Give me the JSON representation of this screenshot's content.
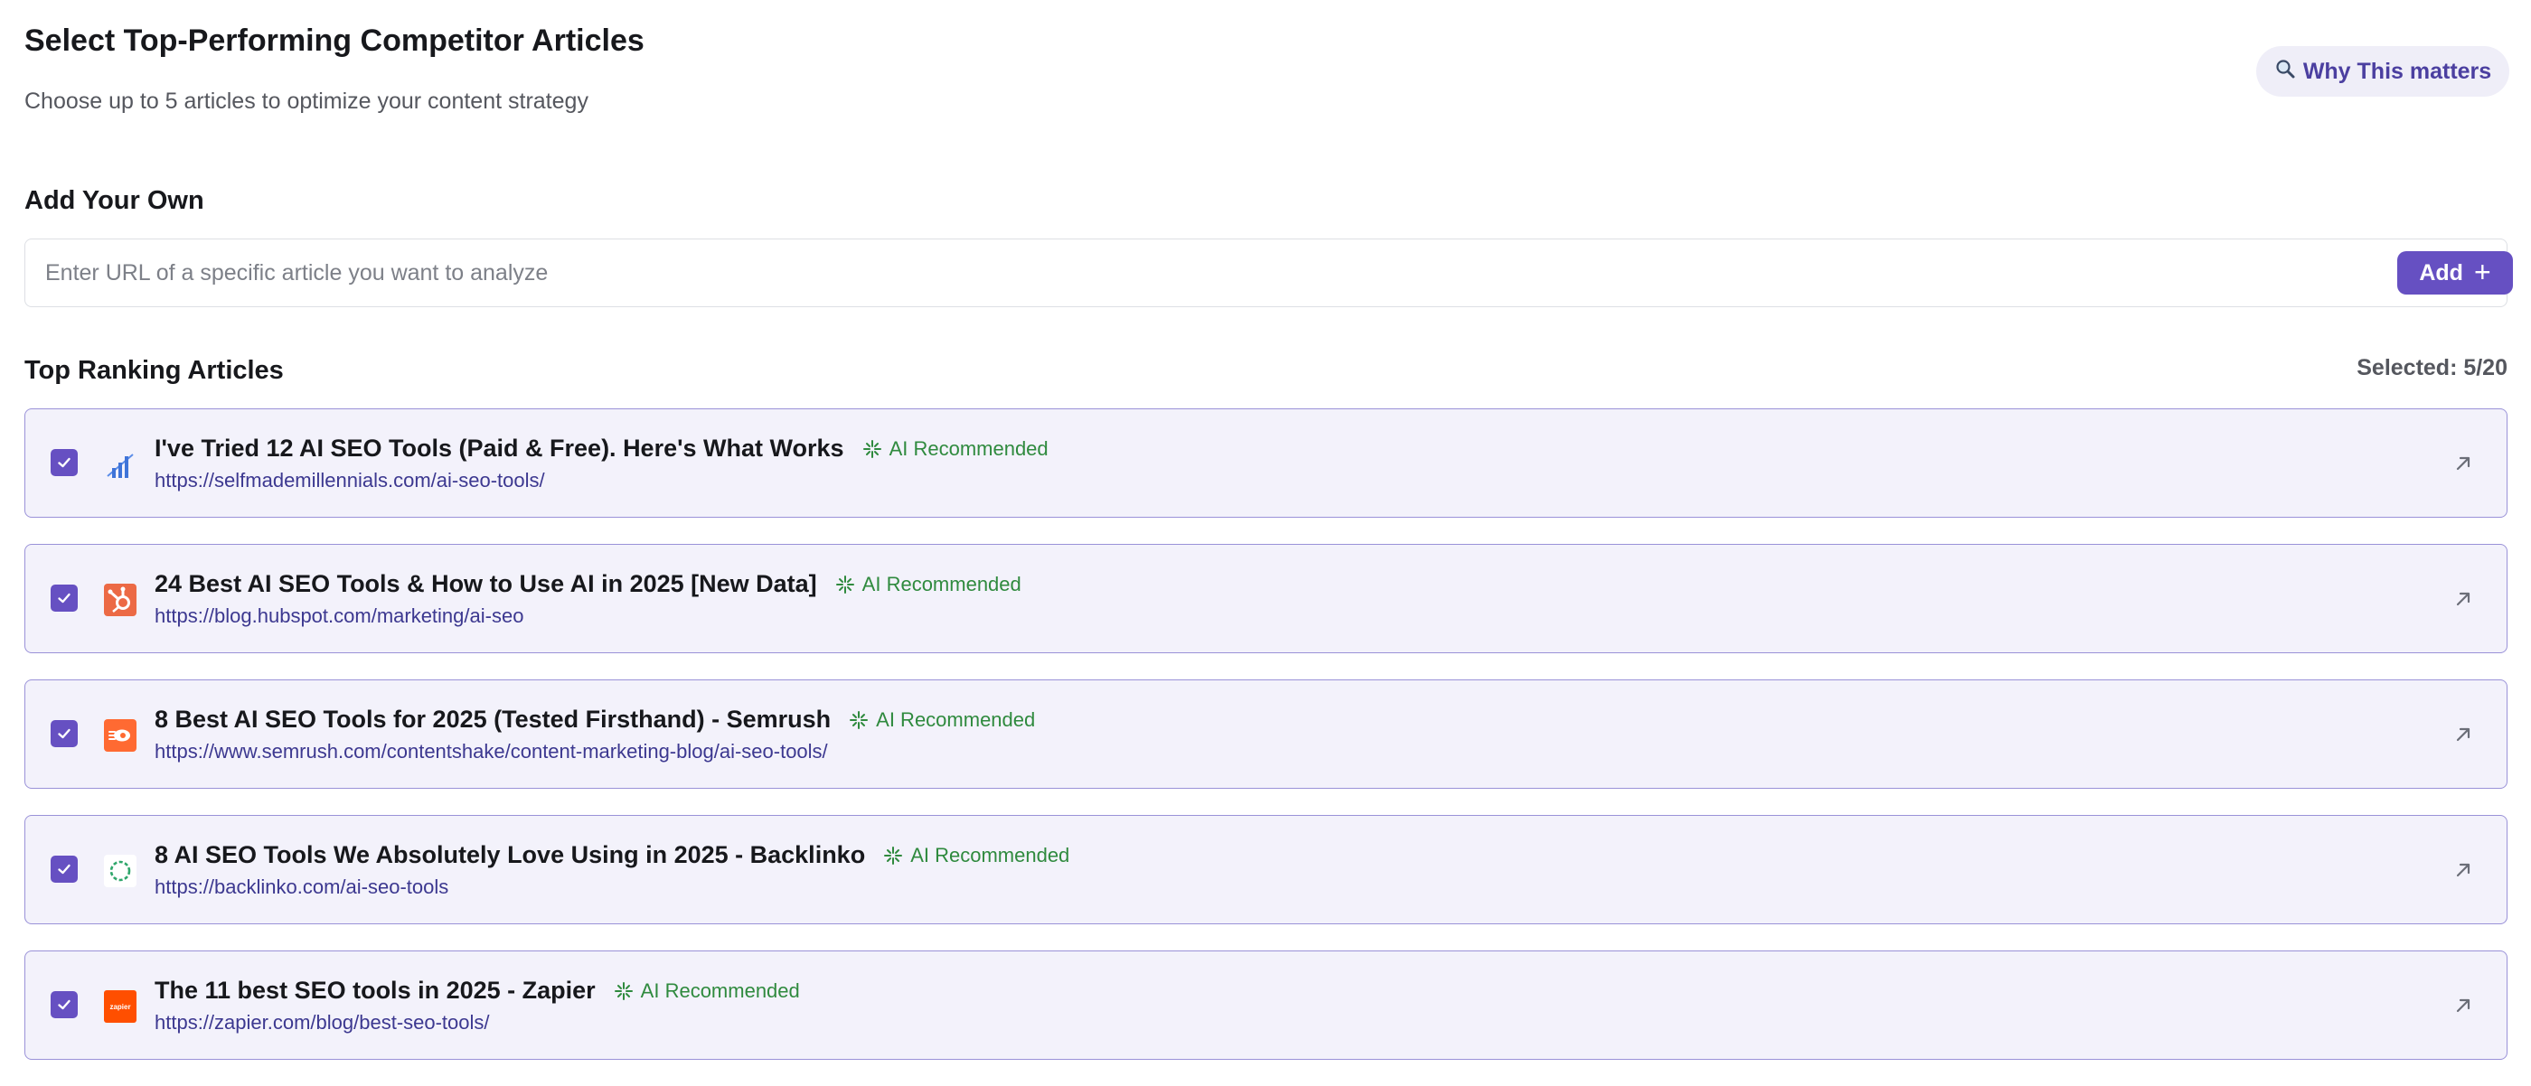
{
  "header": {
    "title": "Select Top-Performing Competitor Articles",
    "subtitle": "Choose up to 5 articles to optimize your content strategy",
    "why_button": "Why This matters"
  },
  "add_own": {
    "title": "Add Your Own",
    "placeholder": "Enter URL of a specific article you want to analyze",
    "value": "",
    "add_label": "Add"
  },
  "top_ranking": {
    "title": "Top Ranking Articles",
    "selected_text": "Selected: 5/20"
  },
  "badge_label": "AI Recommended",
  "colors": {
    "accent": "#6650c2",
    "card_border": "#9a92d8",
    "card_bg": "#f3f2fb",
    "badge_green": "#2f8a3e",
    "link": "#3c3890"
  },
  "articles": [
    {
      "title": "I've Tried 12 AI SEO Tools (Paid & Free). Here's What Works",
      "url": "https://selfmademillennials.com/ai-seo-tools/",
      "checked": true,
      "ai_recommended": true,
      "icon": "bar-chart-icon"
    },
    {
      "title": "24 Best AI SEO Tools & How to Use AI in 2025 [New Data]",
      "url": "https://blog.hubspot.com/marketing/ai-seo",
      "checked": true,
      "ai_recommended": true,
      "icon": "hubspot-logo-icon"
    },
    {
      "title": "8 Best AI SEO Tools for 2025 (Tested Firsthand) - Semrush",
      "url": "https://www.semrush.com/contentshake/content-marketing-blog/ai-seo-tools/",
      "checked": true,
      "ai_recommended": true,
      "icon": "semrush-logo-icon"
    },
    {
      "title": "8 AI SEO Tools We Absolutely Love Using in 2025 - Backlinko",
      "url": "https://backlinko.com/ai-seo-tools",
      "checked": true,
      "ai_recommended": true,
      "icon": "backlinko-logo-icon"
    },
    {
      "title": "The 11 best SEO tools in 2025 - Zapier",
      "url": "https://zapier.com/blog/best-seo-tools/",
      "checked": true,
      "ai_recommended": true,
      "icon": "zapier-logo-icon",
      "icon_text": "zapier"
    }
  ]
}
